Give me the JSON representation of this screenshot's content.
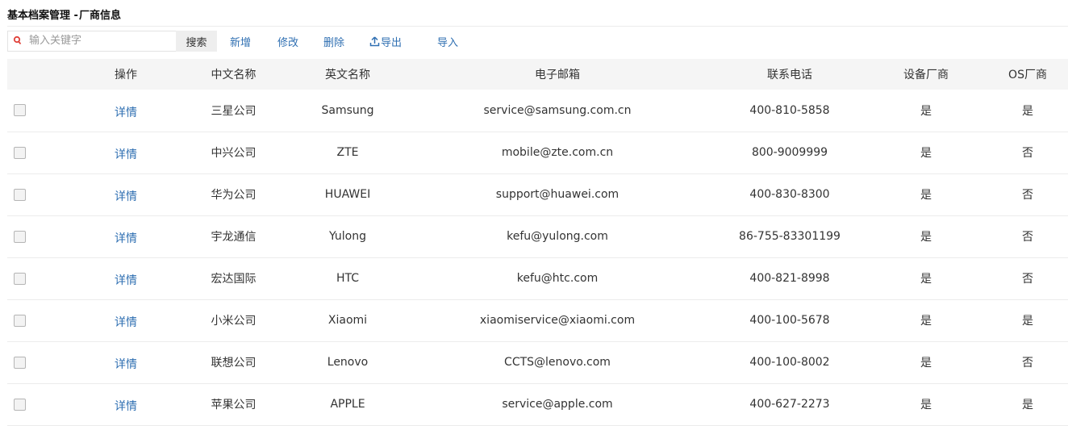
{
  "header": {
    "title": "基本档案管理 -",
    "subtitle": "厂商信息"
  },
  "toolbar": {
    "search_placeholder": "输入关键字",
    "search_button": "搜索",
    "add": "新增",
    "edit": "修改",
    "delete": "删除",
    "export": "导出",
    "import": "导入"
  },
  "colors": {
    "link": "#2f6fb2",
    "search_icon": "#e0413a",
    "header_bg": "#f5f5f5"
  },
  "table": {
    "columns": [
      "操作",
      "中文名称",
      "英文名称",
      "电子邮箱",
      "联系电话",
      "设备厂商",
      "OS厂商"
    ],
    "rows": [
      {
        "op": "详情",
        "cn": "三星公司",
        "en": "Samsung",
        "email": "service@samsung.com.cn",
        "phone": "400-810-5858",
        "device": "是",
        "os": "是"
      },
      {
        "op": "详情",
        "cn": "中兴公司",
        "en": "ZTE",
        "email": "mobile@zte.com.cn",
        "phone": "800-9009999",
        "device": "是",
        "os": "否"
      },
      {
        "op": "详情",
        "cn": "华为公司",
        "en": "HUAWEI",
        "email": "support@huawei.com",
        "phone": "400-830-8300",
        "device": "是",
        "os": "否"
      },
      {
        "op": "详情",
        "cn": "宇龙通信",
        "en": "Yulong",
        "email": "kefu@yulong.com",
        "phone": "86-755-83301199",
        "device": "是",
        "os": "否"
      },
      {
        "op": "详情",
        "cn": "宏达国际",
        "en": "HTC",
        "email": "kefu@htc.com",
        "phone": "400-821-8998",
        "device": "是",
        "os": "否"
      },
      {
        "op": "详情",
        "cn": "小米公司",
        "en": "Xiaomi",
        "email": "xiaomiservice@xiaomi.com",
        "phone": "400-100-5678",
        "device": "是",
        "os": "是"
      },
      {
        "op": "详情",
        "cn": "联想公司",
        "en": "Lenovo",
        "email": "CCTS@lenovo.com",
        "phone": "400-100-8002",
        "device": "是",
        "os": "否"
      },
      {
        "op": "详情",
        "cn": "苹果公司",
        "en": "APPLE",
        "email": "service@apple.com",
        "phone": "400-627-2273",
        "device": "是",
        "os": "是"
      }
    ]
  }
}
